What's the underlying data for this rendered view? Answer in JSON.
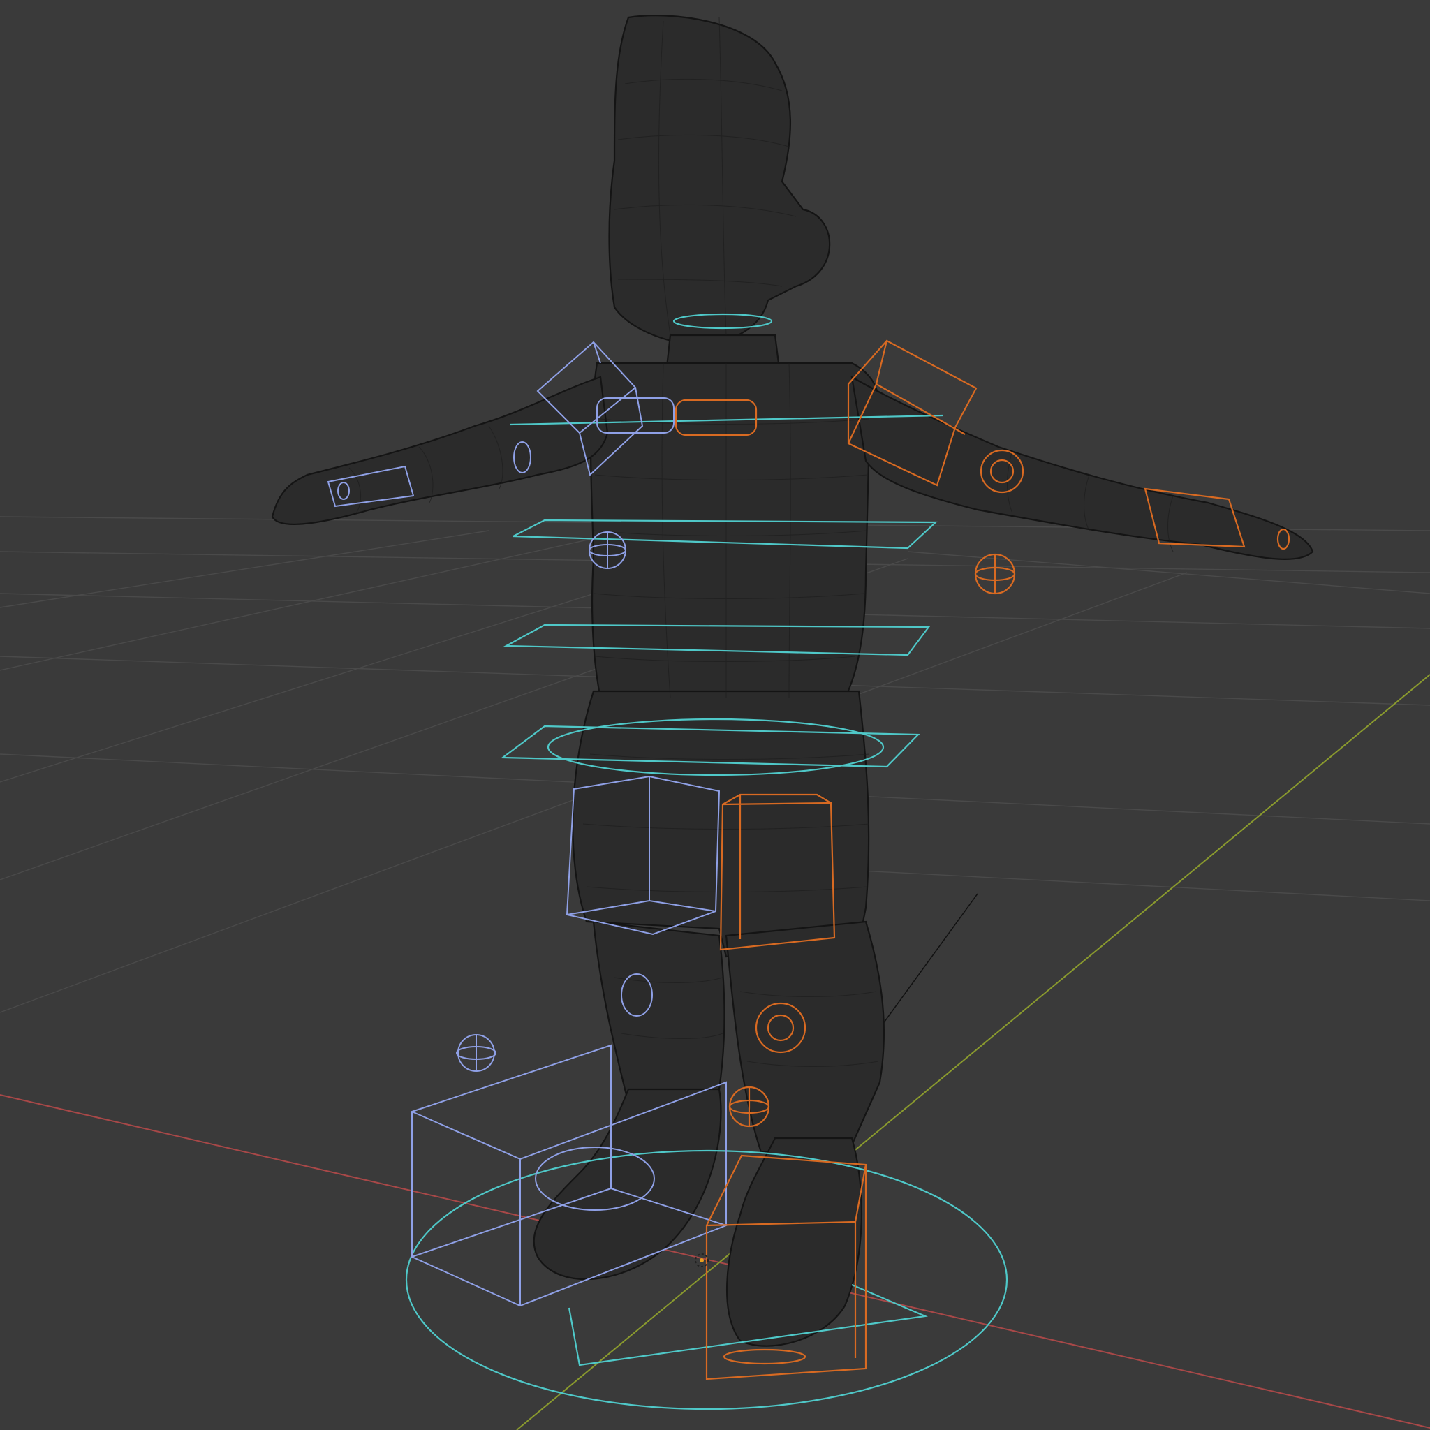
{
  "viewport": {
    "mode": "wireframe",
    "background": "#3a3a3a",
    "grid_color": "#4a4a4a",
    "axis_x_color": "#a84848",
    "axis_y_color": "#8a9a2e",
    "mesh_wire_color": "#141414"
  },
  "rig": {
    "center_controls_color": "#4fc8c8",
    "left_controls_color": "#8fa0e6",
    "right_controls_color": "#d86a22",
    "icons": [
      "sphere-control-icon",
      "cube-control-icon",
      "circle-control-icon",
      "origin-icon"
    ]
  }
}
